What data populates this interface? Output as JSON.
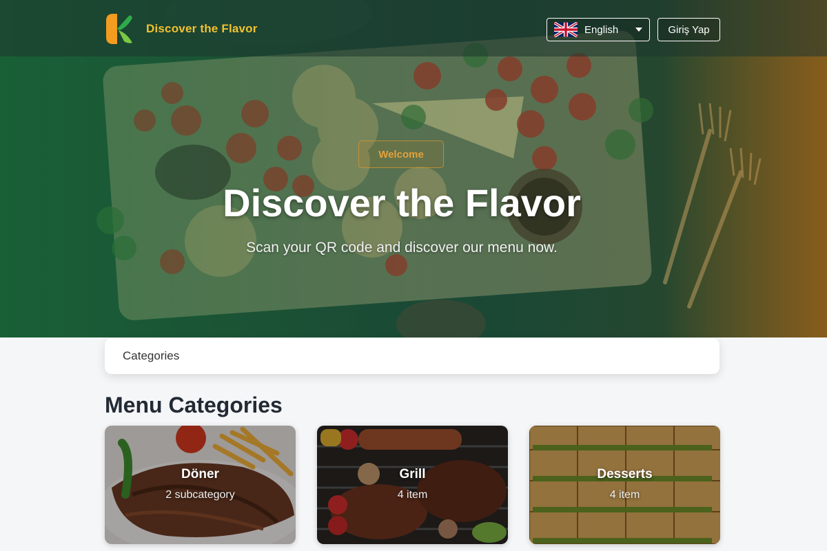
{
  "brand": {
    "name": "Discover the Flavor"
  },
  "nav": {
    "language_label": "English",
    "login_label": "Giriş Yap"
  },
  "hero": {
    "badge": "Welcome",
    "title": "Discover the Flavor",
    "subtitle": "Scan your QR code and discover our menu now."
  },
  "categories_bar": {
    "label": "Categories"
  },
  "menu": {
    "title": "Menu Categories",
    "cards": [
      {
        "name": "Döner",
        "count": "2 subcategory"
      },
      {
        "name": "Grill",
        "count": "4 item"
      },
      {
        "name": "Desserts",
        "count": "4 item"
      }
    ]
  },
  "colors": {
    "brand_text": "#f2c230",
    "badge_text": "#e3a13a",
    "hero_green": "#1f5a34"
  }
}
